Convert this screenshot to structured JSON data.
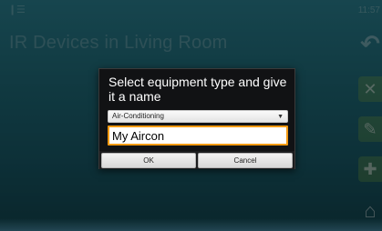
{
  "status_bar": {
    "time": "11:57",
    "left_icons": [
      "notification-icon",
      "wifi-icon"
    ]
  },
  "page": {
    "title": "IR Devices in Living Room"
  },
  "sidebar": {
    "buttons": [
      "back-icon",
      "close-icon",
      "edit-icon",
      "add-icon",
      "home-icon"
    ]
  },
  "dialog": {
    "title": "Select equipment type and give it a name",
    "equipment_type": "Air-Conditioning",
    "name_value": "My Aircon",
    "ok_label": "OK",
    "cancel_label": "Cancel"
  },
  "colors": {
    "accent_orange": "#f39a12",
    "sidebar_green": "#78aa46",
    "background_teal": "#2a7f8f"
  }
}
